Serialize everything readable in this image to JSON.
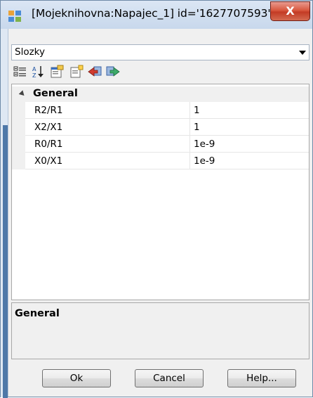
{
  "window": {
    "title": "[Mojeknihovna:Napajec_1] id='1627707593'",
    "close_label": "X",
    "icons": {
      "app": "app-window-icon",
      "close": "close-icon"
    },
    "colors": {
      "close_button": "#c33b25",
      "frame": "#dfe8f3",
      "accent": "#4e78a8"
    }
  },
  "combo": {
    "selected": "Slozky"
  },
  "toolbar": {
    "icons": [
      "categorized-icon",
      "alphabetical-sort-icon",
      "property-pages-icon",
      "new-item-icon",
      "back-arrow-icon",
      "forward-arrow-icon"
    ]
  },
  "grid": {
    "category": "General",
    "properties": [
      {
        "name": "R2/R1",
        "value": "1"
      },
      {
        "name": "X2/X1",
        "value": "1"
      },
      {
        "name": "R0/R1",
        "value": "1e-9"
      },
      {
        "name": "X0/X1",
        "value": "1e-9"
      }
    ]
  },
  "help": {
    "title": "General"
  },
  "buttons": {
    "ok": "Ok",
    "cancel": "Cancel",
    "help": "Help..."
  }
}
